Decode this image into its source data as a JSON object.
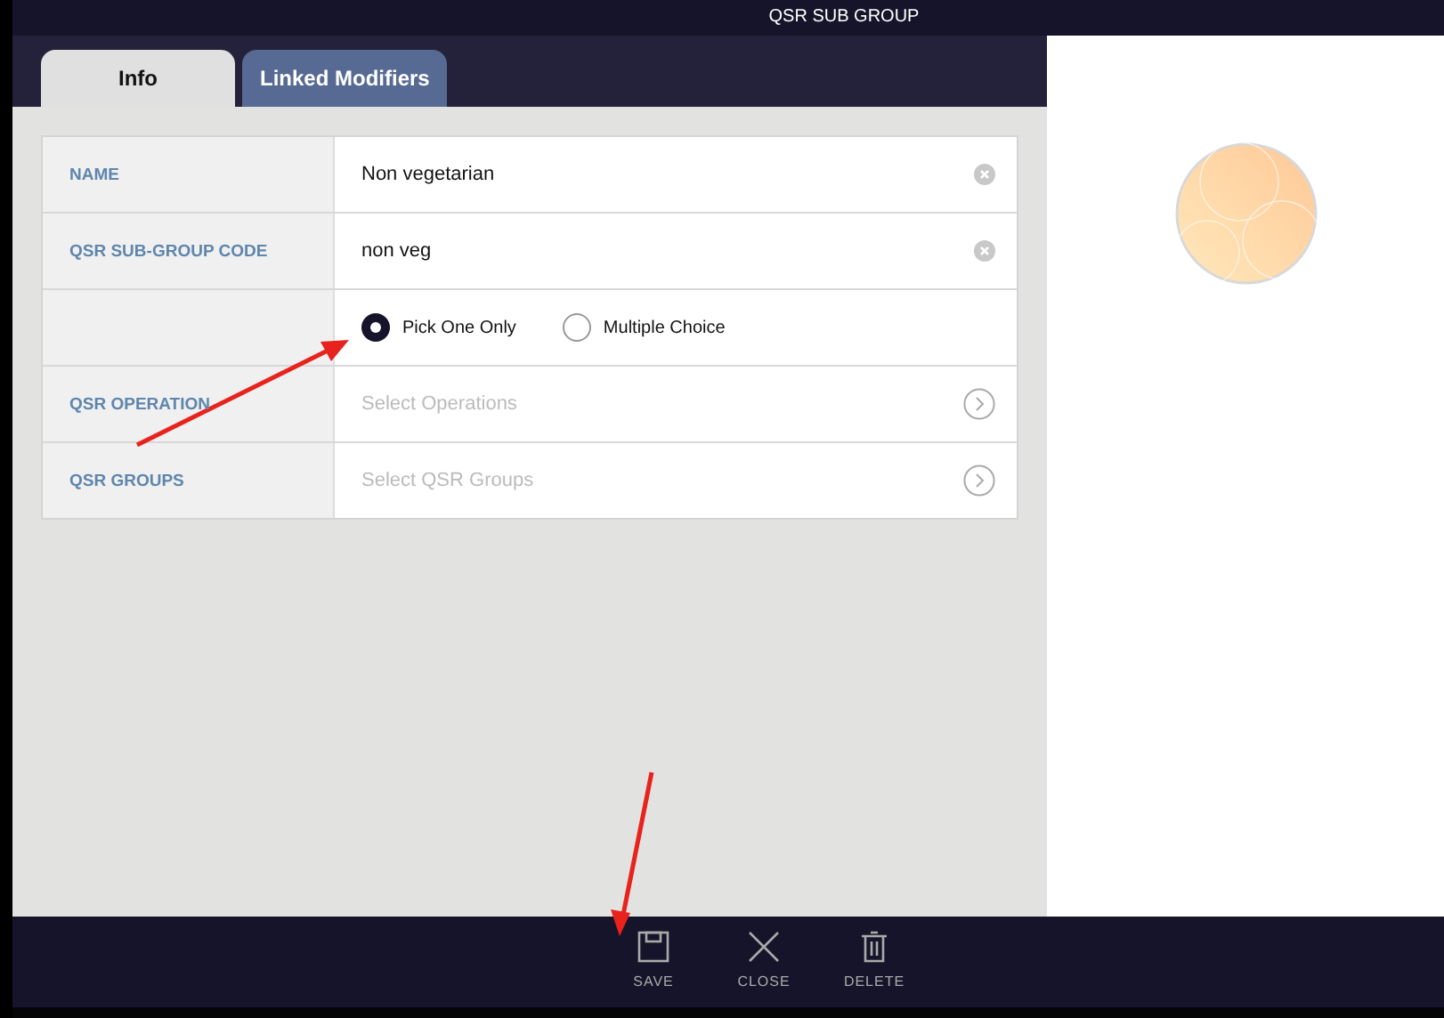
{
  "window": {
    "title": "QSR SUB GROUP"
  },
  "tabs": [
    {
      "label": "Info",
      "selected": true
    },
    {
      "label": "Linked Modifiers",
      "selected": false
    }
  ],
  "form": [
    {
      "kind": "text",
      "label": "NAME",
      "value": "Non vegetarian"
    },
    {
      "kind": "text",
      "label": "QSR SUB-GROUP CODE",
      "value": "non veg"
    },
    {
      "kind": "radio",
      "options": [
        {
          "label": "Pick One Only",
          "selected": true
        },
        {
          "label": "Multiple Choice",
          "selected": false
        }
      ]
    },
    {
      "kind": "select",
      "label": "QSR OPERATION",
      "placeholder": "Select Operations"
    },
    {
      "kind": "select",
      "label": "QSR GROUPS",
      "placeholder": "Select QSR Groups"
    }
  ],
  "toolbar": [
    {
      "kind": "save",
      "label": "SAVE"
    },
    {
      "kind": "close",
      "label": "CLOSE"
    },
    {
      "kind": "delete",
      "label": "DELETE"
    }
  ]
}
